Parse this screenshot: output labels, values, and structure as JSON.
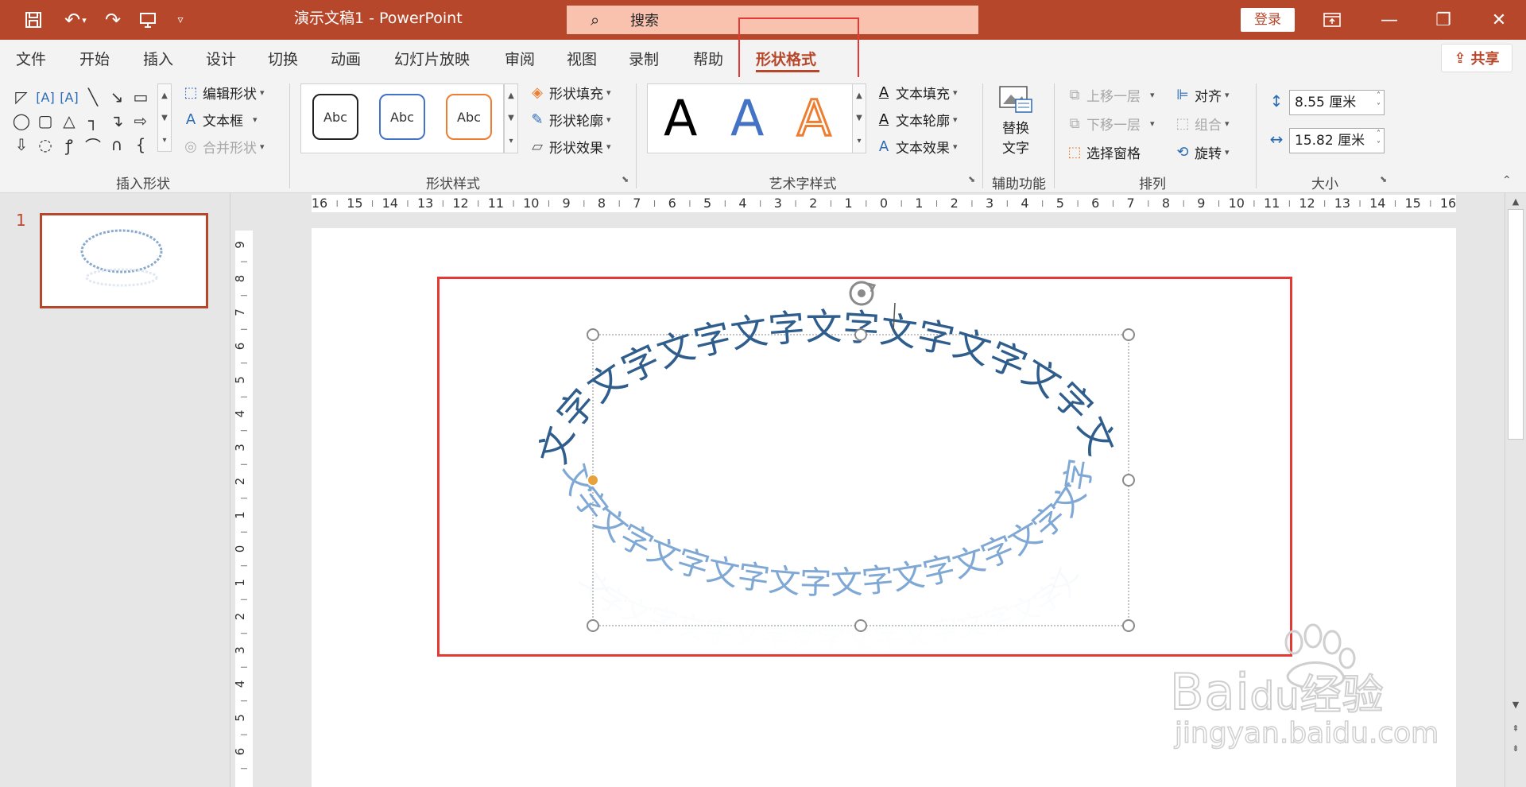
{
  "window": {
    "title": "演示文稿1  -  PowerPoint",
    "search_placeholder": "搜索",
    "login_label": "登录",
    "share_label": "共享"
  },
  "tabs": [
    {
      "label": "文件"
    },
    {
      "label": "开始"
    },
    {
      "label": "插入"
    },
    {
      "label": "设计"
    },
    {
      "label": "切换"
    },
    {
      "label": "动画"
    },
    {
      "label": "幻灯片放映"
    },
    {
      "label": "审阅"
    },
    {
      "label": "视图"
    },
    {
      "label": "录制"
    },
    {
      "label": "帮助"
    },
    {
      "label": "形状格式",
      "active": true
    }
  ],
  "ribbon": {
    "insert_shapes": {
      "edit_shape": "编辑形状",
      "text_box": "文本框",
      "merge_shapes": "合并形状",
      "label": "插入形状"
    },
    "shape_styles": {
      "preview_text": "Abc",
      "fill": "形状填充",
      "outline": "形状轮廓",
      "effects": "形状效果",
      "label": "形状样式"
    },
    "wordart": {
      "glyph": "A",
      "text_fill": "文本填充",
      "text_outline": "文本轮廓",
      "text_effects": "文本效果",
      "label": "艺术字样式"
    },
    "accessibility": {
      "alt_text_line1": "替换",
      "alt_text_line2": "文字",
      "label": "辅助功能"
    },
    "arrange": {
      "bring_forward": "上移一层",
      "send_backward": "下移一层",
      "selection_pane": "选择窗格",
      "align": "对齐",
      "group": "组合",
      "rotate": "旋转",
      "label": "排列"
    },
    "size": {
      "height": "8.55 厘米",
      "width": "15.82 厘米",
      "label": "大小"
    }
  },
  "slides_panel": {
    "slide_number": "1"
  },
  "rulers": {
    "horizontal": [
      "16",
      "15",
      "14",
      "13",
      "12",
      "11",
      "10",
      "9",
      "8",
      "7",
      "6",
      "5",
      "4",
      "3",
      "2",
      "1",
      "0",
      "1",
      "2",
      "3",
      "4",
      "5",
      "6",
      "7",
      "8",
      "9",
      "10",
      "11",
      "12",
      "13",
      "14",
      "15",
      "16"
    ],
    "vertical": [
      "9",
      "8",
      "7",
      "6",
      "5",
      "4",
      "3",
      "2",
      "1",
      "0",
      "1",
      "2",
      "3",
      "4",
      "5",
      "6"
    ]
  },
  "slide": {
    "arc_text": "文字文字文字文字文字文字文字文字文字文字文字文字文字文字文字文字文字文字文字文字文字"
  },
  "watermark": {
    "brand_left": "Bai",
    "brand_mid": "du",
    "brand_right": "经验",
    "url": "jingyan.baidu.com"
  },
  "colors": {
    "accent": "#b7472a",
    "highlight": "#e53935",
    "wordart_blue": "#4472c4",
    "wordart_orange": "#ed7d31"
  }
}
